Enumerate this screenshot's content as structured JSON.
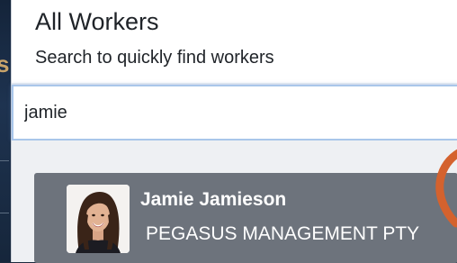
{
  "background": {
    "left_glyph": "s"
  },
  "modal": {
    "title": "All Workers",
    "subtitle": "Search to quickly find workers",
    "search": {
      "value": "jamie"
    },
    "results": [
      {
        "name": "Jamie Jamieson",
        "company": "PEGASUS MANAGEMENT PTY"
      }
    ],
    "loading_indicator": true
  },
  "colors": {
    "card_background": "#6d737c",
    "spinner": "#d4622e",
    "search_focus_border": "#a9c6ea"
  },
  "icons": {
    "avatar": "worker-photo",
    "loading": "loading-spinner-icon"
  }
}
